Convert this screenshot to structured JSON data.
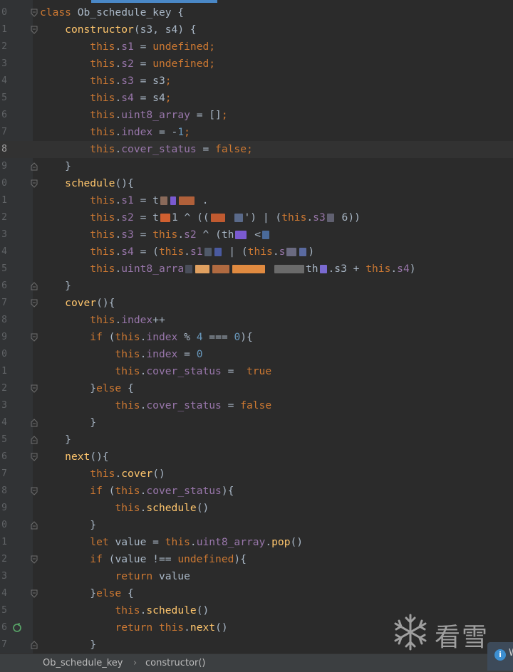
{
  "editor": {
    "lines": [
      {
        "n": "0",
        "fold": "open",
        "current": false,
        "tokens": [
          [
            "k",
            "class "
          ],
          [
            "t",
            "Ob_schedule_key {"
          ]
        ]
      },
      {
        "n": "1",
        "fold": "open",
        "current": false,
        "tokens": [
          [
            "t",
            "    "
          ],
          [
            "f",
            "constructor"
          ],
          [
            "t",
            "(s3, s4) {"
          ]
        ]
      },
      {
        "n": "2",
        "fold": "",
        "current": false,
        "tokens": [
          [
            "t",
            "        "
          ],
          [
            "k",
            "this"
          ],
          [
            "t",
            "."
          ],
          [
            "p",
            "s1"
          ],
          [
            "t",
            " = "
          ],
          [
            "k",
            "undefined"
          ],
          [
            "k",
            ";"
          ]
        ]
      },
      {
        "n": "3",
        "fold": "",
        "current": false,
        "tokens": [
          [
            "t",
            "        "
          ],
          [
            "k",
            "this"
          ],
          [
            "t",
            "."
          ],
          [
            "p",
            "s2"
          ],
          [
            "t",
            " = "
          ],
          [
            "k",
            "undefined"
          ],
          [
            "k",
            ";"
          ]
        ]
      },
      {
        "n": "4",
        "fold": "",
        "current": false,
        "tokens": [
          [
            "t",
            "        "
          ],
          [
            "k",
            "this"
          ],
          [
            "t",
            "."
          ],
          [
            "p",
            "s3"
          ],
          [
            "t",
            " = s3"
          ],
          [
            "k",
            ";"
          ]
        ]
      },
      {
        "n": "5",
        "fold": "",
        "current": false,
        "tokens": [
          [
            "t",
            "        "
          ],
          [
            "k",
            "this"
          ],
          [
            "t",
            "."
          ],
          [
            "p",
            "s4"
          ],
          [
            "t",
            " = s4"
          ],
          [
            "k",
            ";"
          ]
        ]
      },
      {
        "n": "6",
        "fold": "",
        "current": false,
        "tokens": [
          [
            "t",
            "        "
          ],
          [
            "k",
            "this"
          ],
          [
            "t",
            "."
          ],
          [
            "p",
            "uint8_array"
          ],
          [
            "t",
            " = []"
          ],
          [
            "k",
            ";"
          ]
        ]
      },
      {
        "n": "7",
        "fold": "",
        "current": false,
        "tokens": [
          [
            "t",
            "        "
          ],
          [
            "k",
            "this"
          ],
          [
            "t",
            "."
          ],
          [
            "p",
            "index"
          ],
          [
            "t",
            " = -"
          ],
          [
            "n",
            "1"
          ],
          [
            "k",
            ";"
          ]
        ]
      },
      {
        "n": "8",
        "fold": "",
        "current": true,
        "tokens": [
          [
            "t",
            "        "
          ],
          [
            "k",
            "this"
          ],
          [
            "t",
            "."
          ],
          [
            "p",
            "cover_status"
          ],
          [
            "t",
            " = "
          ],
          [
            "k",
            "false"
          ],
          [
            "k",
            ";"
          ]
        ]
      },
      {
        "n": "9",
        "fold": "close",
        "current": false,
        "tokens": [
          [
            "t",
            "    }"
          ]
        ]
      },
      {
        "n": "0",
        "fold": "open",
        "current": false,
        "tokens": [
          [
            "t",
            "    "
          ],
          [
            "f",
            "schedule"
          ],
          [
            "t",
            "(){"
          ]
        ]
      },
      {
        "n": "1",
        "fold": "",
        "current": false,
        "tokens": [
          [
            "t",
            "        "
          ],
          [
            "k",
            "this"
          ],
          [
            "t",
            "."
          ],
          [
            "p",
            "s1"
          ],
          [
            "t",
            " = t"
          ],
          [
            "b",
            "#8a6a5a:10"
          ],
          [
            "b",
            "#7a5ad0:8"
          ],
          [
            "b",
            "#b0603a:22"
          ],
          [
            "t",
            " ."
          ]
        ]
      },
      {
        "n": "2",
        "fold": "",
        "current": false,
        "tokens": [
          [
            "t",
            "        "
          ],
          [
            "k",
            "this"
          ],
          [
            "t",
            "."
          ],
          [
            "p",
            "s2"
          ],
          [
            "t",
            " = t"
          ],
          [
            "b",
            "#d06030:14"
          ],
          [
            "t",
            "1 ^ (("
          ],
          [
            "b",
            "#c05a30:20"
          ],
          [
            "t",
            " "
          ],
          [
            "b",
            "#5a6a8a:12"
          ],
          [
            "t",
            "') | ("
          ],
          [
            "k",
            "this"
          ],
          [
            "t",
            "."
          ],
          [
            "p",
            "s3"
          ],
          [
            "b",
            "#606070:10"
          ],
          [
            "t",
            " 6))"
          ]
        ]
      },
      {
        "n": "3",
        "fold": "",
        "current": false,
        "tokens": [
          [
            "t",
            "        "
          ],
          [
            "k",
            "this"
          ],
          [
            "t",
            "."
          ],
          [
            "p",
            "s3"
          ],
          [
            "t",
            " = "
          ],
          [
            "k",
            "this"
          ],
          [
            "t",
            "."
          ],
          [
            "p",
            "s2"
          ],
          [
            "t",
            " ^ (th"
          ],
          [
            "b",
            "#7a5ad0:16"
          ],
          [
            "t",
            " <"
          ],
          [
            "b",
            "#4a6a9a:10"
          ]
        ]
      },
      {
        "n": "4",
        "fold": "",
        "current": false,
        "tokens": [
          [
            "t",
            "        "
          ],
          [
            "k",
            "this"
          ],
          [
            "t",
            "."
          ],
          [
            "p",
            "s4"
          ],
          [
            "t",
            " = ("
          ],
          [
            "k",
            "this"
          ],
          [
            "t",
            "."
          ],
          [
            "p",
            "s1"
          ],
          [
            "b",
            "#505a6a:10"
          ],
          [
            "b",
            "#4a5aa0:10"
          ],
          [
            "t",
            " | ("
          ],
          [
            "k",
            "this"
          ],
          [
            "t",
            "."
          ],
          [
            "p",
            "s"
          ],
          [
            "b",
            "#6a6a80:14"
          ],
          [
            "b",
            "#5a6aa0:10"
          ],
          [
            "t",
            ")"
          ]
        ]
      },
      {
        "n": "5",
        "fold": "",
        "current": false,
        "tokens": [
          [
            "t",
            "        "
          ],
          [
            "k",
            "this"
          ],
          [
            "t",
            "."
          ],
          [
            "p",
            "uint8_arra"
          ],
          [
            "b",
            "#4a4e5a:10"
          ],
          [
            "b",
            "#e0a060:20"
          ],
          [
            "b",
            "#b06a40:24"
          ],
          [
            "b",
            "#e08a40:46"
          ],
          [
            "t",
            " "
          ],
          [
            "b",
            "#6a6a6a:42"
          ],
          [
            "t",
            "th"
          ],
          [
            "b",
            "#7a6ad0:10"
          ],
          [
            "t",
            ".s3 + "
          ],
          [
            "k",
            "this"
          ],
          [
            "t",
            "."
          ],
          [
            "p",
            "s4"
          ],
          [
            "t",
            ")"
          ]
        ]
      },
      {
        "n": "6",
        "fold": "close",
        "current": false,
        "tokens": [
          [
            "t",
            "    }"
          ]
        ]
      },
      {
        "n": "7",
        "fold": "open",
        "current": false,
        "tokens": [
          [
            "t",
            "    "
          ],
          [
            "f",
            "cover"
          ],
          [
            "t",
            "(){"
          ]
        ]
      },
      {
        "n": "8",
        "fold": "",
        "current": false,
        "tokens": [
          [
            "t",
            "        "
          ],
          [
            "k",
            "this"
          ],
          [
            "t",
            "."
          ],
          [
            "p",
            "index"
          ],
          [
            "t",
            "++"
          ]
        ]
      },
      {
        "n": "9",
        "fold": "open",
        "current": false,
        "tokens": [
          [
            "t",
            "        "
          ],
          [
            "k",
            "if"
          ],
          [
            "t",
            " ("
          ],
          [
            "k",
            "this"
          ],
          [
            "t",
            "."
          ],
          [
            "p",
            "index"
          ],
          [
            "t",
            " % "
          ],
          [
            "n",
            "4"
          ],
          [
            "t",
            " === "
          ],
          [
            "n",
            "0"
          ],
          [
            "t",
            "){"
          ]
        ]
      },
      {
        "n": "0",
        "fold": "",
        "current": false,
        "tokens": [
          [
            "t",
            "            "
          ],
          [
            "k",
            "this"
          ],
          [
            "t",
            "."
          ],
          [
            "p",
            "index"
          ],
          [
            "t",
            " = "
          ],
          [
            "n",
            "0"
          ]
        ]
      },
      {
        "n": "1",
        "fold": "",
        "current": false,
        "tokens": [
          [
            "t",
            "            "
          ],
          [
            "k",
            "this"
          ],
          [
            "t",
            "."
          ],
          [
            "p",
            "cover_status"
          ],
          [
            "t",
            " =  "
          ],
          [
            "k",
            "true"
          ]
        ]
      },
      {
        "n": "2",
        "fold": "open",
        "current": false,
        "tokens": [
          [
            "t",
            "        }"
          ],
          [
            "k",
            "else"
          ],
          [
            "t",
            " {"
          ]
        ]
      },
      {
        "n": "3",
        "fold": "",
        "current": false,
        "tokens": [
          [
            "t",
            "            "
          ],
          [
            "k",
            "this"
          ],
          [
            "t",
            "."
          ],
          [
            "p",
            "cover_status"
          ],
          [
            "t",
            " = "
          ],
          [
            "k",
            "false"
          ]
        ]
      },
      {
        "n": "4",
        "fold": "close",
        "current": false,
        "tokens": [
          [
            "t",
            "        }"
          ]
        ]
      },
      {
        "n": "5",
        "fold": "close",
        "current": false,
        "tokens": [
          [
            "t",
            "    }"
          ]
        ]
      },
      {
        "n": "6",
        "fold": "open",
        "current": false,
        "tokens": [
          [
            "t",
            "    "
          ],
          [
            "f",
            "next"
          ],
          [
            "t",
            "(){"
          ]
        ]
      },
      {
        "n": "7",
        "fold": "",
        "current": false,
        "tokens": [
          [
            "t",
            "        "
          ],
          [
            "k",
            "this"
          ],
          [
            "t",
            "."
          ],
          [
            "f",
            "cover"
          ],
          [
            "t",
            "()"
          ]
        ]
      },
      {
        "n": "8",
        "fold": "open",
        "current": false,
        "tokens": [
          [
            "t",
            "        "
          ],
          [
            "k",
            "if"
          ],
          [
            "t",
            " ("
          ],
          [
            "k",
            "this"
          ],
          [
            "t",
            "."
          ],
          [
            "p",
            "cover_status"
          ],
          [
            "t",
            "){"
          ]
        ]
      },
      {
        "n": "9",
        "fold": "",
        "current": false,
        "tokens": [
          [
            "t",
            "            "
          ],
          [
            "k",
            "this"
          ],
          [
            "t",
            "."
          ],
          [
            "f",
            "schedule"
          ],
          [
            "t",
            "()"
          ]
        ]
      },
      {
        "n": "0",
        "fold": "close",
        "current": false,
        "tokens": [
          [
            "t",
            "        }"
          ]
        ]
      },
      {
        "n": "1",
        "fold": "",
        "current": false,
        "tokens": [
          [
            "t",
            "        "
          ],
          [
            "k",
            "let"
          ],
          [
            "t",
            " value = "
          ],
          [
            "k",
            "this"
          ],
          [
            "t",
            "."
          ],
          [
            "p",
            "uint8_array"
          ],
          [
            "t",
            "."
          ],
          [
            "f",
            "pop"
          ],
          [
            "t",
            "()"
          ]
        ]
      },
      {
        "n": "2",
        "fold": "open",
        "current": false,
        "tokens": [
          [
            "t",
            "        "
          ],
          [
            "k",
            "if"
          ],
          [
            "t",
            " (value !== "
          ],
          [
            "k",
            "undefined"
          ],
          [
            "t",
            "){"
          ]
        ]
      },
      {
        "n": "3",
        "fold": "",
        "current": false,
        "tokens": [
          [
            "t",
            "            "
          ],
          [
            "k",
            "return"
          ],
          [
            "t",
            " value"
          ]
        ]
      },
      {
        "n": "4",
        "fold": "open",
        "current": false,
        "tokens": [
          [
            "t",
            "        }"
          ],
          [
            "k",
            "else"
          ],
          [
            "t",
            " {"
          ]
        ]
      },
      {
        "n": "5",
        "fold": "",
        "current": false,
        "tokens": [
          [
            "t",
            "            "
          ],
          [
            "k",
            "this"
          ],
          [
            "t",
            "."
          ],
          [
            "f",
            "schedule"
          ],
          [
            "t",
            "()"
          ]
        ]
      },
      {
        "n": "6",
        "fold": "",
        "current": false,
        "run": true,
        "tokens": [
          [
            "t",
            "            "
          ],
          [
            "k",
            "return"
          ],
          [
            "t",
            " "
          ],
          [
            "k",
            "this"
          ],
          [
            "t",
            "."
          ],
          [
            "f",
            "next"
          ],
          [
            "t",
            "()"
          ]
        ]
      },
      {
        "n": "7",
        "fold": "close",
        "current": false,
        "tokens": [
          [
            "t",
            "        }"
          ]
        ]
      }
    ]
  },
  "breadcrumb": {
    "class_name": "Ob_schedule_key",
    "separator": "›",
    "method": "constructor()"
  },
  "watermark": {
    "text": "看雪"
  },
  "notification": {
    "icon": "info-icon",
    "label": "i",
    "text": "W"
  },
  "colors": {
    "background": "#2b2b2b",
    "keyword": "#cc7832",
    "function": "#ffc66d",
    "property": "#9876aa",
    "number": "#6897bb",
    "text": "#a9b7c6",
    "tab_accent": "#4a88c7"
  }
}
